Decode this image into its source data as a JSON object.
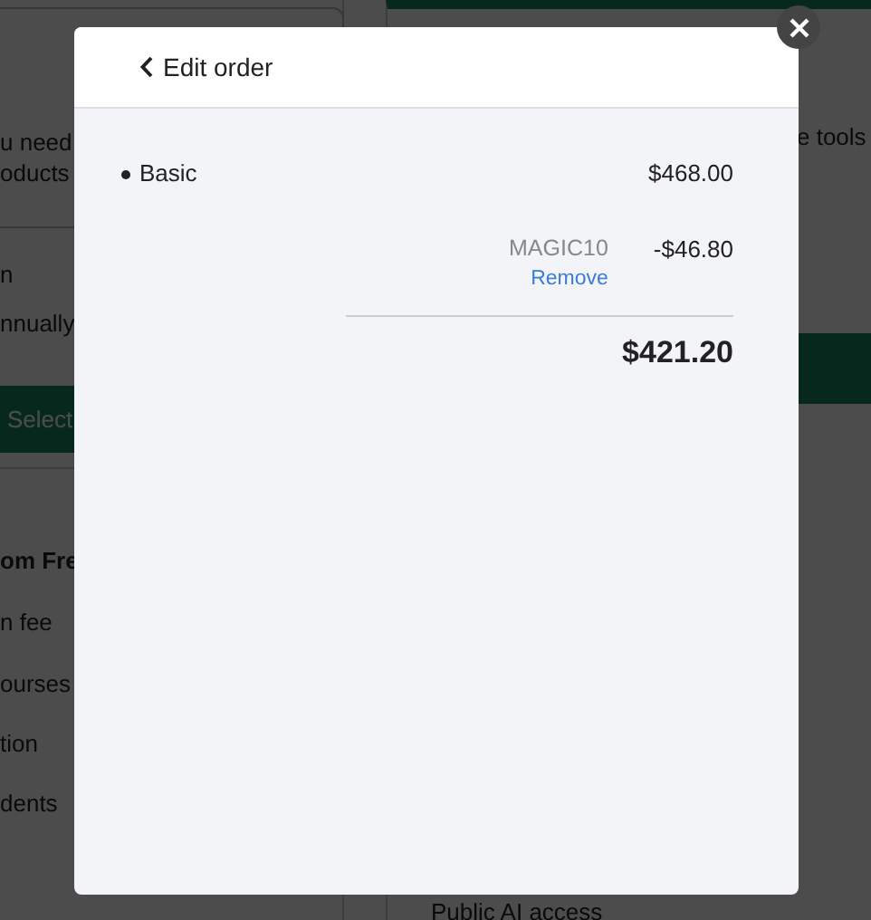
{
  "background": {
    "left_lines": [
      {
        "kind": "text",
        "text": "u need"
      },
      {
        "kind": "text",
        "text": "oducts"
      },
      {
        "kind": "text",
        "text": "n"
      },
      {
        "kind": "text",
        "text": "nnually"
      },
      {
        "kind": "button",
        "text": "Select"
      },
      {
        "kind": "heading",
        "text": "om Fre"
      },
      {
        "kind": "text",
        "text": "n fee"
      },
      {
        "kind": "text",
        "text": "ourses"
      },
      {
        "kind": "text",
        "text": "tion"
      },
      {
        "kind": "text",
        "text": "dents"
      }
    ],
    "right_lines": [
      {
        "kind": "text",
        "text": "e tools"
      },
      {
        "kind": "button"
      },
      {
        "kind": "text",
        "text": "Public AI access"
      }
    ]
  },
  "modal": {
    "back_label": "Edit order",
    "items": [
      {
        "name": "Basic",
        "price": "$468.00"
      }
    ],
    "discount": {
      "code": "MAGIC10",
      "amount": "-$46.80",
      "remove_label": "Remove"
    },
    "total": "$421.20"
  }
}
